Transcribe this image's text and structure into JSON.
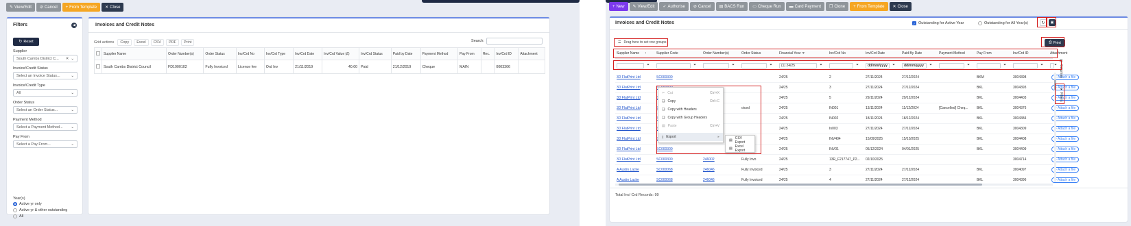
{
  "left": {
    "toolbar": [
      {
        "label": "View/Edit",
        "icon": "edit-icon",
        "color": "#8f959b"
      },
      {
        "label": "Cancel",
        "icon": "cancel-icon",
        "color": "#8f959b"
      },
      {
        "label": "From Template",
        "icon": "plus-icon",
        "color": "#f5a623"
      },
      {
        "label": "Close",
        "icon": "close-icon",
        "color": "#2d3a4f"
      }
    ],
    "filters": {
      "title": "Filters",
      "reset": "Reset",
      "fields": [
        {
          "label": "Supplier",
          "value": "South Cambs District C...",
          "clear": true
        },
        {
          "label": "Invoice/Credit Status",
          "value": "Select an Invoice Status..."
        },
        {
          "label": "Invoice/Credit Type",
          "value": "All"
        },
        {
          "label": "Order Status",
          "value": "Select an Order Status..."
        },
        {
          "label": "Payment Method",
          "value": "Select a Payment Method..."
        },
        {
          "label": "Pay From",
          "value": "Select a Pay From..."
        }
      ],
      "year_label": "Year(s)",
      "year_options": [
        {
          "label": "Active yr only",
          "checked": true
        },
        {
          "label": "Active yr & other outstanding",
          "checked": false
        },
        {
          "label": "All",
          "checked": false
        }
      ]
    },
    "grid": {
      "title": "Invoices and Credit Notes",
      "actions_label": "Grid actions",
      "actions": [
        "Copy",
        "Excel",
        "CSV",
        "PDF",
        "Print"
      ],
      "search_label": "Search:",
      "columns": [
        "Supplier Name",
        "Order Number(s)",
        "Order Status",
        "Inv/Crd No",
        "Inv/Crd Type",
        "Inv/Crd Date",
        "Inv/Crd Value (£)",
        "Inv/Crd Status",
        "Paid by Date",
        "Payment Method",
        "Pay From",
        "Rec.",
        "Inv/Crd ID",
        "Attachment"
      ],
      "rows": [
        [
          "South Cambs District Council",
          "FD1900102",
          "Fully Invoiced",
          "Licence fee",
          "Ord Inv",
          "21/11/2019",
          "40.00",
          "Paid",
          "21/12/2019",
          "Cheque",
          "MAIN",
          "",
          "0003306",
          ""
        ]
      ]
    }
  },
  "right": {
    "toolbar": [
      {
        "label": "New",
        "icon": "plus-icon",
        "color": "#7c3aed"
      },
      {
        "label": "View/Edit",
        "icon": "edit-icon",
        "color": "#8f959b"
      },
      {
        "label": "Authorise",
        "icon": "check-icon",
        "color": "#8f959b"
      },
      {
        "label": "Cancel",
        "icon": "cancel-icon",
        "color": "#8f959b"
      },
      {
        "label": "BACS Run",
        "icon": "bank-icon",
        "color": "#8f959b"
      },
      {
        "label": "Cheque Run",
        "icon": "cheque-icon",
        "color": "#8f959b"
      },
      {
        "label": "Card Payment",
        "icon": "card-icon",
        "color": "#8f959b"
      },
      {
        "label": "Clone",
        "icon": "clone-icon",
        "color": "#8f959b"
      },
      {
        "label": "From Template",
        "icon": "plus-icon",
        "color": "#f5a623"
      },
      {
        "label": "Close",
        "icon": "close-icon",
        "color": "#2d3a4f"
      }
    ],
    "title": "Invoices and Credit Notes",
    "outstanding_active": "Outstanding for Active Year",
    "outstanding_all": "Outstanding for All Year(s)",
    "print": "Print",
    "group_hint": "Drag here to set row groups",
    "columns": [
      "Supplier Name",
      "Supplier Code",
      "Order Number(s)",
      "Order Status",
      "Financial Year",
      "Inv/Crd No",
      "Inv/Crd Date",
      "Paid By Date",
      "Payment Method",
      "Pay From",
      "Inv/Crd ID",
      "Attachment"
    ],
    "filter_values": {
      "year": "(1) 24/25",
      "date1": "dd/mm/yyyy",
      "date2": "dd/mm/yyyy"
    },
    "side_tabs": [
      "Columns",
      "Filters"
    ],
    "rows": [
      [
        "3D FlatPrint Ltd",
        "SC000300",
        "",
        "",
        "24/25",
        "2",
        "27/11/2024",
        "27/12/2024",
        "",
        "BKM",
        "",
        "3004398"
      ],
      [
        "3D FlatPrint Ltd",
        "SC000300",
        "",
        "",
        "24/25",
        "3",
        "27/11/2024",
        "27/12/2024",
        "",
        "BKL",
        "",
        "3004393"
      ],
      [
        "3D FlatPrint Ltd",
        "SC000300",
        "",
        "",
        "24/25",
        "5",
        "29/11/2024",
        "29/12/2024",
        "",
        "BKL",
        "",
        "3004403"
      ],
      [
        "3D FlatPrint Ltd",
        "SC000300",
        "",
        "oiced",
        "24/25",
        "IN001",
        "13/11/2024",
        "11/12/2024",
        "[Cancelled] Cheq...",
        "BKL",
        "",
        "3004376"
      ],
      [
        "3D FlatPrint Ltd",
        "SC000300",
        "",
        "",
        "24/25",
        "IN002",
        "18/11/2024",
        "18/12/2024",
        "",
        "BKL",
        "",
        "3004384"
      ],
      [
        "3D FlatPrint Ltd",
        "SC000300",
        "",
        "",
        "24/25",
        "In003",
        "27/11/2024",
        "27/12/2024",
        "",
        "BKL",
        "",
        "3004309"
      ],
      [
        "3D FlatPrint Ltd",
        "SC000300",
        "",
        "",
        "24/25",
        "INV404",
        "15/09/2025",
        "15/10/2025",
        "",
        "BKL",
        "",
        "3004408"
      ],
      [
        "3D FlatPrint Ltd",
        "SC000300",
        "",
        "",
        "24/25",
        "INV01",
        "05/12/2024",
        "04/01/2025",
        "",
        "BKL",
        "",
        "3004409"
      ],
      [
        "3D FlatPrint Ltd",
        "SC000300",
        "246002",
        "Fully Invo",
        "24/25",
        "13R_F217747_P2...",
        "02/10/2025",
        "",
        "",
        "",
        "",
        "3004714"
      ],
      [
        "A Austin Lacke",
        "SC000068",
        "246046",
        "Fully Invoiced",
        "24/25",
        "3",
        "27/11/2024",
        "27/12/2024",
        "",
        "BKL",
        "",
        "3004097"
      ],
      [
        "A Austin Lacke",
        "SC000068",
        "246046",
        "Fully Invoiced",
        "24/25",
        "4",
        "27/11/2024",
        "27/12/2024",
        "",
        "BKL",
        "",
        "3004396"
      ]
    ],
    "attach_label": "+ Attach a file",
    "context_menu": [
      {
        "label": "Cut",
        "shortcut": "Ctrl+X",
        "icon": "cut-icon",
        "disabled": true
      },
      {
        "label": "Copy",
        "shortcut": "Ctrl+C",
        "icon": "copy-icon",
        "disabled": false
      },
      {
        "label": "Copy with Headers",
        "shortcut": "",
        "icon": "copy-icon",
        "disabled": false
      },
      {
        "label": "Copy with Group Headers",
        "shortcut": "",
        "icon": "copy-icon",
        "disabled": false
      },
      {
        "label": "Paste",
        "shortcut": "Ctrl+V",
        "icon": "paste-icon",
        "disabled": true
      },
      {
        "label": "Export",
        "shortcut": "",
        "icon": "export-icon",
        "disabled": false
      }
    ],
    "export_menu": [
      "CSV Export",
      "Excel Export"
    ],
    "total_label": "Total Inv/ Crd Records: 99"
  }
}
